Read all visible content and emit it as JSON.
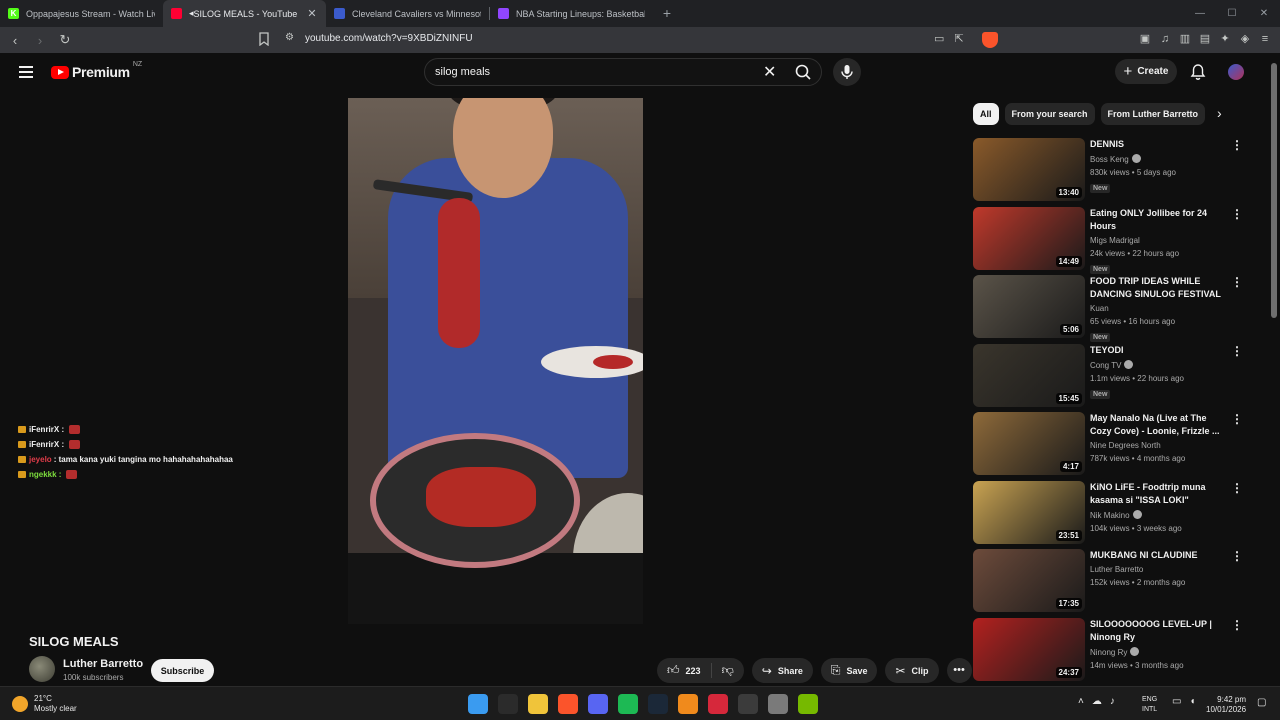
{
  "browser": {
    "tabs": [
      {
        "title": "Oppapajesus Stream - Watch Live on",
        "favicon_color": "#53fc18",
        "favicon_char": "K",
        "active": false
      },
      {
        "title": "SILOG MEALS - YouTube",
        "favicon_color": "#ff0033",
        "favicon_char": "",
        "active": true
      },
      {
        "title": "Cleveland Cavaliers vs Minnesota Tim",
        "favicon_color": "#3b5bcc",
        "favicon_char": "",
        "active": false
      },
      {
        "title": "NBA Starting Lineups: Basketball Dai",
        "favicon_color": "#9146ff",
        "favicon_char": "",
        "active": false
      }
    ],
    "new_tab": "+",
    "url": "youtube.com/watch?v=9XBDiZNINFU"
  },
  "yt": {
    "logo_text": "Premium",
    "country_code": "NZ",
    "search_query": "silog meals",
    "create_label": "Create"
  },
  "chat": [
    {
      "user": "iFenrirX :",
      "user_color": "#f1f1f1",
      "message": "",
      "emote": true
    },
    {
      "user": "iFenrirX :",
      "user_color": "#f1f1f1",
      "message": "",
      "emote": true
    },
    {
      "user": "jeyelo",
      "user_color": "#e23c4a",
      "message": ": tama kana yuki tangina mo hahahahahahahaa",
      "emote": false
    },
    {
      "user": "ngekkk :",
      "user_color": "#7ddc3d",
      "message": "",
      "emote": true
    }
  ],
  "video": {
    "title": "SILOG MEALS",
    "channel": "Luther Barretto",
    "subscribers": "100k subscribers",
    "subscribe_label": "Subscribe",
    "likes": "223",
    "share_label": "Share",
    "save_label": "Save",
    "clip_label": "Clip"
  },
  "chips": [
    "All",
    "From your search",
    "From Luther Barretto"
  ],
  "recommendations": [
    {
      "title": "DENNIS",
      "channel": "Boss Keng",
      "verified": true,
      "meta": "830k views • 5 days ago",
      "badge": "New",
      "duration": "13:40",
      "thumb": "#8a5a2a"
    },
    {
      "title": "Eating ONLY Jollibee for 24 Hours",
      "channel": "Migs Madrigal",
      "verified": false,
      "meta": "24k views • 22 hours ago",
      "badge": "New",
      "duration": "14:49",
      "thumb": "#c0392b"
    },
    {
      "title": "FOOD TRIP IDEAS WHILE DANCING SINULOG FESTIVAL ...",
      "channel": "Kuan",
      "verified": false,
      "meta": "65 views • 16 hours ago",
      "badge": "New",
      "duration": "5:06",
      "thumb": "#5b5449"
    },
    {
      "title": "TEYODI",
      "channel": "Cong TV",
      "verified": true,
      "meta": "1.1m views • 22 hours ago",
      "badge": "New",
      "duration": "15:45",
      "thumb": "#3a352c"
    },
    {
      "title": "May Nanalo Na (Live at The Cozy Cove) - Loonie, Frizzle ...",
      "channel": "Nine Degrees North",
      "verified": false,
      "meta": "787k views • 4 months ago",
      "badge": "",
      "duration": "4:17",
      "thumb": "#8e6a3a"
    },
    {
      "title": "KiNO LiFE - Foodtrip muna kasama si \"ISSA LOKI\"",
      "channel": "Nik Makino",
      "verified": true,
      "meta": "104k views • 3 weeks ago",
      "badge": "",
      "duration": "23:51",
      "thumb": "#c9a352"
    },
    {
      "title": "MUKBANG NI CLAUDINE",
      "channel": "Luther Barretto",
      "verified": false,
      "meta": "152k views • 2 months ago",
      "badge": "",
      "duration": "17:35",
      "thumb": "#6d4b3b"
    },
    {
      "title": "SILOOOOOOOG LEVEL-UP | Ninong Ry",
      "channel": "Ninong Ry",
      "verified": true,
      "meta": "14m views • 3 months ago",
      "badge": "",
      "duration": "24:37",
      "thumb": "#b3211f"
    }
  ],
  "taskbar": {
    "temp": "21°C",
    "weather": "Mostly clear",
    "lang1": "ENG",
    "lang2": "INTL",
    "time": "9:42 pm",
    "date": "10/01/2026",
    "apps": [
      {
        "name": "windows-start-icon",
        "color": "#3a9bf0"
      },
      {
        "name": "search-icon",
        "color": "#2b2b2b"
      },
      {
        "name": "file-explorer-icon",
        "color": "#f0c43a"
      },
      {
        "name": "brave-icon",
        "color": "#fb542b"
      },
      {
        "name": "discord-icon",
        "color": "#5865f2"
      },
      {
        "name": "spotify-icon",
        "color": "#1db954"
      },
      {
        "name": "steam-icon",
        "color": "#1b2838"
      },
      {
        "name": "vlc-icon",
        "color": "#f08a1c"
      },
      {
        "name": "app-red-icon",
        "color": "#d6283b"
      },
      {
        "name": "obs-icon",
        "color": "#3b3b3b"
      },
      {
        "name": "settings-icon",
        "color": "#7a7a7a"
      },
      {
        "name": "nvidia-icon",
        "color": "#76b900"
      }
    ]
  }
}
